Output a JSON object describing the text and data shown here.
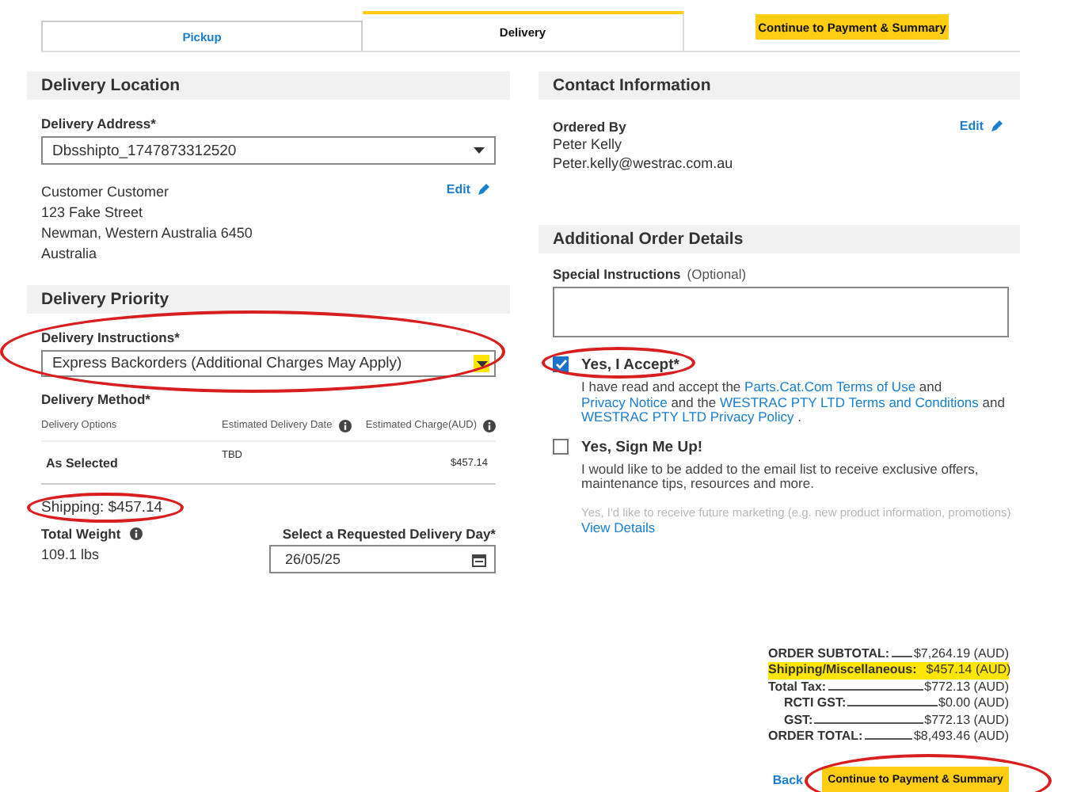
{
  "tabs": [
    {
      "label": "Pickup",
      "selected": false
    },
    {
      "label": "Delivery",
      "selected": true
    }
  ],
  "top_button": {
    "label": "Continue to Payment & Summary"
  },
  "delivery_location": {
    "title": "Delivery Location",
    "address_label": "Delivery Address*",
    "address_value": "Dbsshipto_1747873312520",
    "edit": "Edit",
    "address_lines": [
      "Customer Customer",
      "123 Fake Street",
      "Newman, Western Australia 6450",
      "Australia"
    ]
  },
  "delivery_priority": {
    "title": "Delivery Priority",
    "instructions_label": "Delivery Instructions*",
    "instructions_value": "Express Backorders (Additional Charges May Apply)",
    "instructions_circled": true,
    "caret_highlighted": true,
    "method_label": "Delivery Method*",
    "columns": [
      {
        "label": "Delivery Options",
        "info": false
      },
      {
        "label": "Estimated Delivery Date",
        "info": true
      },
      {
        "label": "Estimated Charge(AUD)",
        "info": true
      }
    ],
    "rows": [
      {
        "option": "As Selected",
        "date": "TBD",
        "charge": "$457.14"
      }
    ],
    "shipping": "Shipping: $457.14",
    "shipping_circled": true,
    "weight_label": "Total Weight",
    "weight_value": "109.1 lbs",
    "day_label": "Select a Requested Delivery Day*",
    "day_value": "26/05/25"
  },
  "contact": {
    "title": "Contact Information",
    "ordered_by_label": "Ordered By",
    "edit": "Edit",
    "name": "Peter Kelly",
    "email": "Peter.kelly@westrac.com.au"
  },
  "order_details": {
    "title": "Additional Order Details",
    "special_label": "Special Instructions",
    "special_hint": "(Optional)",
    "consents": [
      {
        "title": "Yes, I Accept*",
        "checked": true,
        "circled": true,
        "parts": [
          {
            "kind": "text",
            "text": "I have read and accept the"
          },
          {
            "kind": "link",
            "text": "Parts.Cat.Com Terms of Use"
          },
          {
            "kind": "text",
            "text": "and"
          },
          {
            "kind": "link",
            "text": "Privacy Notice"
          },
          {
            "kind": "text",
            "text": "and the"
          },
          {
            "kind": "link",
            "text": "WESTRAC PTY LTD Terms and Conditions"
          },
          {
            "kind": "text",
            "text": "and"
          },
          {
            "kind": "link",
            "text": "WESTRAC PTY LTD Privacy Policy"
          },
          {
            "kind": "text",
            "text": "."
          }
        ]
      },
      {
        "title": "Yes, Sign Me Up!",
        "checked": false,
        "circled": false,
        "parts": [
          {
            "kind": "text",
            "text": "I would like to be added to the email list to receive exclusive offers, maintenance tips, resources and more."
          }
        ]
      }
    ],
    "faded_note": "Yes, I'd like to receive future marketing (e.g. new product information, promotions)",
    "view_details": "View Details"
  },
  "summary": {
    "rows": [
      {
        "label": "ORDER SUBTOTAL:",
        "value": "$7,264.19 (AUD)",
        "highlighted": false
      },
      {
        "label": "Shipping/Miscellaneous:",
        "value": "$457.14 (AUD)",
        "highlighted": true
      },
      {
        "label": "Total Tax:",
        "value": "$772.13 (AUD)",
        "highlighted": false,
        "children": [
          {
            "label": "RCTI GST:",
            "value": "$0.00 (AUD)",
            "highlighted": false
          },
          {
            "label": "GST:",
            "value": "$772.13 (AUD)",
            "highlighted": false
          }
        ]
      },
      {
        "label": "ORDER TOTAL:",
        "value": "$8,493.46 (AUD)",
        "highlighted": false
      }
    ],
    "back": "Back",
    "continue": {
      "label": "Continue to Payment & Summary",
      "circled": true
    }
  }
}
